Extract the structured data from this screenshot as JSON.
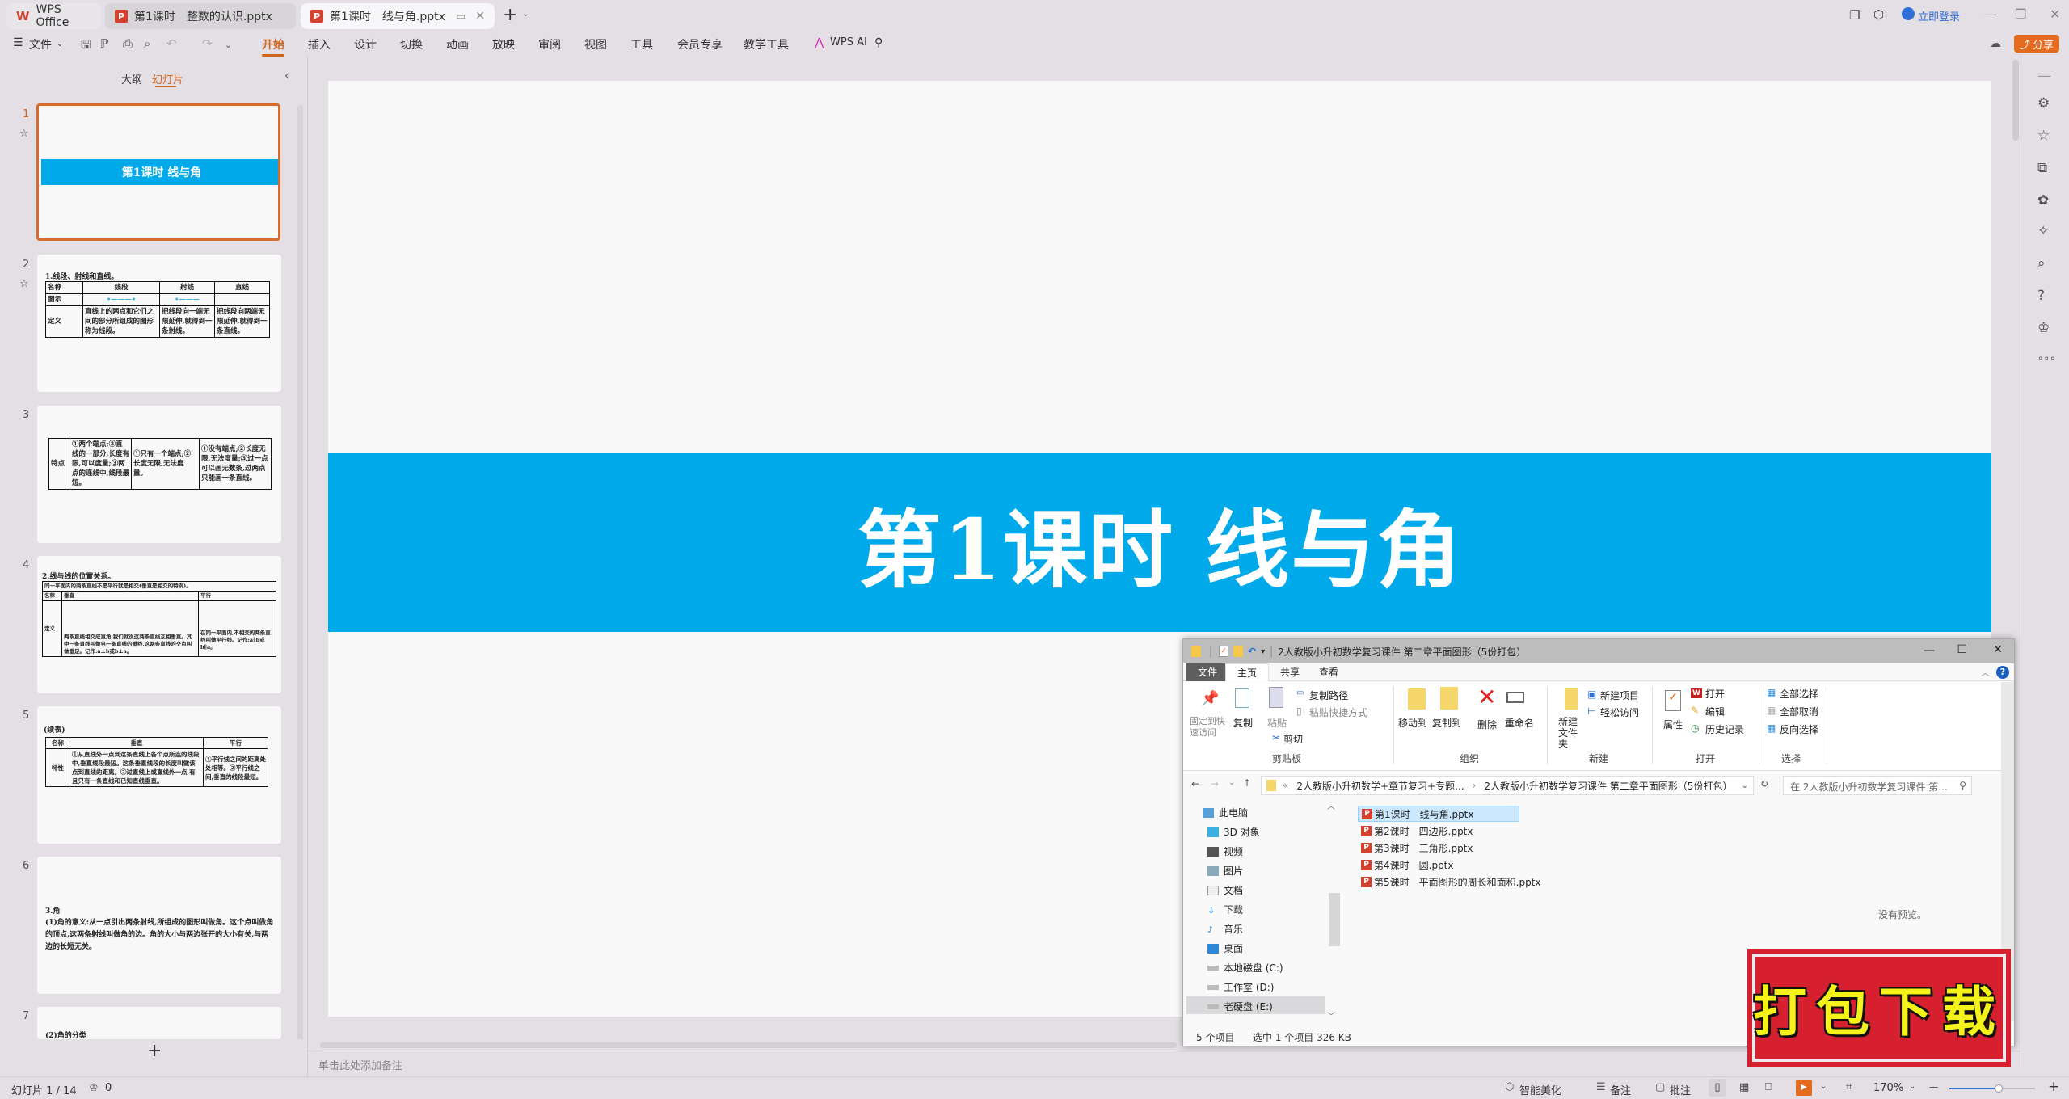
{
  "tabs": [
    {
      "label": "WPS Office",
      "icon": "wps-logo-icon"
    },
    {
      "label": "第1课时　整数的认识.pptx",
      "icon": "ppt-icon"
    },
    {
      "label": "第1课时　线与角.pptx",
      "icon": "ppt-icon",
      "active": true
    }
  ],
  "titlebar": {
    "login": "立即登录",
    "share": "分享"
  },
  "menu": {
    "file": "文件",
    "items": [
      "开始",
      "插入",
      "设计",
      "切换",
      "动画",
      "放映",
      "审阅",
      "视图",
      "工具",
      "会员专享",
      "教学工具"
    ],
    "active_index": 0,
    "wps_ai": "WPS AI"
  },
  "panel": {
    "tab_outline": "大纲",
    "tab_slides": "幻灯片",
    "add_slide": "+"
  },
  "thumbs": {
    "s1": {
      "num": "1",
      "title": "第1课时  线与角"
    },
    "s2": {
      "num": "2",
      "heading": "1.线段、射线和直线。",
      "h": [
        "名称",
        "线段",
        "射线",
        "直线"
      ],
      "r1": "图示",
      "r2": "定义",
      "d1": "直线上的两点和它们之间的部分所组成的图形称为线段。",
      "d2": "把线段向一端无限延伸,就得到一条射线。",
      "d3": "把线段向两端无限延伸,就得到一条直线。"
    },
    "s3": {
      "num": "3",
      "label": "特点",
      "c1": "①两个端点;②直线的一部分,长度有限,可以度量;③两点的连线中,线段最短。",
      "c2": "①只有一个端点;②长度无限,无法度量。",
      "c3": "①没有端点;②长度无限,无法度量;③过一点可以画无数条,过两点只能画一条直线。"
    },
    "s4": {
      "num": "4",
      "heading": "2.线与线的位置关系。",
      "note": "同一平面内的两条直线不是平行就是相交(垂直是相交的特例)。",
      "h": [
        "名称",
        "垂直",
        "平行"
      ],
      "r": "定义",
      "c1": "两条直线相交成直角,我们就说这两条直线互相垂直。其中一条直线叫做另一条直线的垂线,这两条直线的交点叫做垂足。记作:a⊥b或b⊥a。",
      "c2": "在同一平面内,不相交的两条直线叫做平行线。记作:a∥b或b∥a。"
    },
    "s5": {
      "num": "5",
      "heading": "(续表)",
      "h": [
        "名称",
        "垂直",
        "平行"
      ],
      "r": "特性",
      "c1": "①从直线外一点到这条直线上各个点所连的线段中,垂直线段最短。这条垂直线段的长度叫做该点到直线的距离。②过直线上或直线外一点,有且只有一条直线和已知直线垂直。",
      "c2": "①平行线之间的距离处处相等。②平行线之间,垂直的线段最短。"
    },
    "s6": {
      "num": "6",
      "heading": "3.角",
      "text": "(1)角的意义:从一点引出两条射线,所组成的图形叫做角。这个点叫做角的顶点,这两条射线叫做角的边。角的大小与两边张开的大小有关,与两边的长短无关。"
    },
    "s7": {
      "num": "7",
      "heading": "(2)角的分类"
    }
  },
  "slide": {
    "title": "第1课时  线与角",
    "banner_color": "#00aaea"
  },
  "notes_placeholder": "单击此处添加备注",
  "status": {
    "slide_info": "幻灯片 1 / 14",
    "comments": "0",
    "beautify": "智能美化",
    "notes": "备注",
    "annotate": "批注",
    "zoom": "170%",
    "zoom_fraction": 0.58
  },
  "explorer": {
    "title": "2人教版小升初数学复习课件  第二章平面图形（5份打包）",
    "tabs": [
      "文件",
      "主页",
      "共享",
      "查看"
    ],
    "ribbon": {
      "pin": "固定到快速访问",
      "copy": "复制",
      "paste": "粘贴",
      "copy_path": "复制路径",
      "paste_shortcut": "粘贴快捷方式",
      "cut": "剪切",
      "group_clipboard": "剪贴板",
      "move_to": "移动到",
      "copy_to": "复制到",
      "delete": "删除",
      "rename": "重命名",
      "group_organize": "组织",
      "new_folder": "新建文件夹",
      "new_item": "新建项目",
      "easy_access": "轻松访问",
      "group_new": "新建",
      "properties": "属性",
      "open": "打开",
      "edit": "编辑",
      "history": "历史记录",
      "group_open": "打开",
      "select_all": "全部选择",
      "select_none": "全部取消",
      "invert": "反向选择",
      "group_select": "选择"
    },
    "path": [
      "2人教版小升初数学+章节复习+专题...",
      "2人教版小升初数学复习课件  第二章平面图形（5份打包）"
    ],
    "search_placeholder": "在 2人教版小升初数学复习课件  第...",
    "nav": [
      "此电脑",
      "3D 对象",
      "视频",
      "图片",
      "文档",
      "下载",
      "音乐",
      "桌面",
      "本地磁盘 (C:)",
      "工作室 (D:)",
      "老硬盘 (E:)"
    ],
    "files": [
      "第1课时　线与角.pptx",
      "第2课时　四边形.pptx",
      "第3课时　三角形.pptx",
      "第4课时　圆.pptx",
      "第5课时　平面图形的周长和面积.pptx"
    ],
    "selected_file_index": 0,
    "no_preview": "没有预览。",
    "status_count": "5 个项目",
    "status_selected": "选中 1 个项目  326 KB"
  },
  "stamp": {
    "text": "打包下载"
  }
}
